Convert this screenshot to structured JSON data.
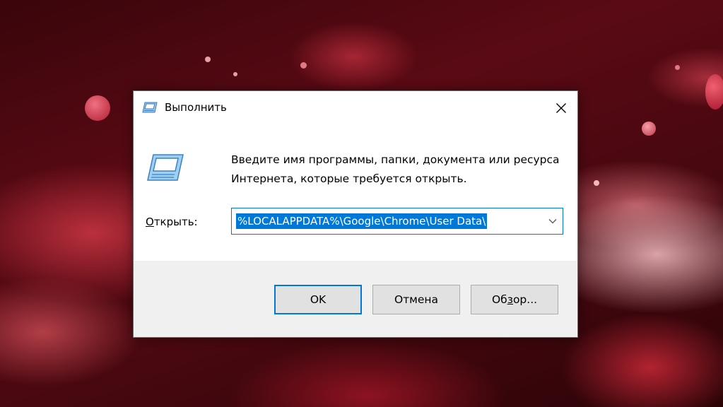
{
  "window": {
    "title": "Выполнить",
    "close_icon": "close-icon"
  },
  "prompt": {
    "message": "Введите имя программы, папки, документа или ресурса Интернета, которые требуется открыть.",
    "icon": "run-icon"
  },
  "open_field": {
    "label_accel": "О",
    "label_rest": "ткрыть:",
    "value": "%LOCALAPPDATA%\\Google\\Chrome\\User Data\\",
    "dropdown_icon": "chevron-down-icon"
  },
  "buttons": {
    "ok": "OK",
    "cancel": "Отмена",
    "browse_pre": "Об",
    "browse_accel": "з",
    "browse_post": "ор..."
  },
  "colors": {
    "accent": "#0078d7",
    "footer_bg": "#f0f0f0",
    "button_bg": "#e1e1e1"
  }
}
